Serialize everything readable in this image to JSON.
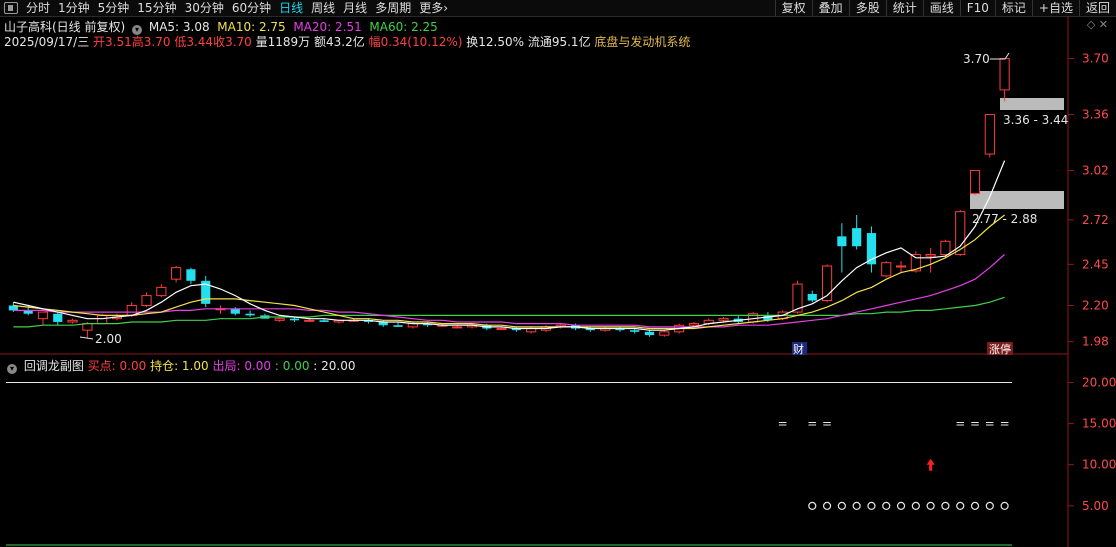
{
  "toolbar": {
    "periods": [
      "分时",
      "1分钟",
      "5分钟",
      "15分钟",
      "30分钟",
      "60分钟",
      "日线",
      "周线",
      "月线",
      "多周期",
      "更多"
    ],
    "active_index": 6,
    "more_arrow": "›",
    "right_buttons": [
      "复权",
      "叠加",
      "多股",
      "统计",
      "画线",
      "F10",
      "标记",
      "+自选",
      "返回"
    ]
  },
  "header": {
    "stock": "山子高科(日线 前复权)",
    "ma5": "MA5: 3.08",
    "ma10": "MA10: 2.75",
    "ma20": "MA20: 2.51",
    "ma60": "MA60: 2.25",
    "date": "2025/09/17/三",
    "open": "开3.51",
    "high": "高3.70",
    "low": "低3.44",
    "close": "收3.70",
    "volume": "量1189万",
    "amount": "额43.2亿",
    "change": "幅0.34(10.12%)",
    "turnover": "换12.50%",
    "float": "流通95.1亿",
    "system": "底盘与发动机系统"
  },
  "main_axis": [
    "3.70",
    "3.36",
    "3.02",
    "2.72",
    "2.45",
    "2.20",
    "1.98"
  ],
  "annotations": {
    "high_label": "3.70",
    "low_label": "2.00",
    "zone1_label": "3.36 - 3.44",
    "zone2_label": "2.77 - 2.88",
    "cai_label": "财",
    "zhangting_label": "涨停"
  },
  "sub_header": {
    "name": "回调龙副图",
    "buy": "买点: 0.00",
    "hold": "持仓: 1.00",
    "exit": "出局: 0.00",
    "v1": ": 0.00",
    "v2": ": 20.00"
  },
  "sub_axis": [
    "20.00",
    "15.00",
    "10.00",
    "5.00"
  ],
  "colors": {
    "up": "#ff3b3b",
    "down": "#22e0ee",
    "ma5": "#ffffff",
    "ma10": "#f2e24a",
    "ma20": "#e63fe6",
    "ma60": "#3fd24a"
  },
  "chart_data": {
    "type": "candlestick",
    "ylim": [
      1.96,
      3.74
    ],
    "candles": [
      {
        "o": 2.2,
        "h": 2.22,
        "l": 2.16,
        "c": 2.17
      },
      {
        "o": 2.17,
        "h": 2.2,
        "l": 2.14,
        "c": 2.15
      },
      {
        "o": 2.12,
        "h": 2.16,
        "l": 2.08,
        "c": 2.16
      },
      {
        "o": 2.15,
        "h": 2.16,
        "l": 2.08,
        "c": 2.1
      },
      {
        "o": 2.1,
        "h": 2.12,
        "l": 2.09,
        "c": 2.11
      },
      {
        "o": 2.05,
        "h": 2.1,
        "l": 2.0,
        "c": 2.09
      },
      {
        "o": 2.09,
        "h": 2.15,
        "l": 2.09,
        "c": 2.14
      },
      {
        "o": 2.12,
        "h": 2.15,
        "l": 2.11,
        "c": 2.13
      },
      {
        "o": 2.14,
        "h": 2.22,
        "l": 2.13,
        "c": 2.2
      },
      {
        "o": 2.2,
        "h": 2.28,
        "l": 2.19,
        "c": 2.26
      },
      {
        "o": 2.26,
        "h": 2.33,
        "l": 2.25,
        "c": 2.31
      },
      {
        "o": 2.36,
        "h": 2.44,
        "l": 2.34,
        "c": 2.43
      },
      {
        "o": 2.42,
        "h": 2.43,
        "l": 2.33,
        "c": 2.35
      },
      {
        "o": 2.35,
        "h": 2.38,
        "l": 2.19,
        "c": 2.21
      },
      {
        "o": 2.18,
        "h": 2.2,
        "l": 2.15,
        "c": 2.18
      },
      {
        "o": 2.18,
        "h": 2.19,
        "l": 2.14,
        "c": 2.15
      },
      {
        "o": 2.15,
        "h": 2.17,
        "l": 2.13,
        "c": 2.14
      },
      {
        "o": 2.14,
        "h": 2.15,
        "l": 2.12,
        "c": 2.12
      },
      {
        "o": 2.11,
        "h": 2.13,
        "l": 2.1,
        "c": 2.12
      },
      {
        "o": 2.12,
        "h": 2.13,
        "l": 2.1,
        "c": 2.11
      },
      {
        "o": 2.11,
        "h": 2.12,
        "l": 2.1,
        "c": 2.11
      },
      {
        "o": 2.11,
        "h": 2.12,
        "l": 2.1,
        "c": 2.1
      },
      {
        "o": 2.1,
        "h": 2.11,
        "l": 2.09,
        "c": 2.11
      },
      {
        "o": 2.11,
        "h": 2.12,
        "l": 2.1,
        "c": 2.11
      },
      {
        "o": 2.11,
        "h": 2.12,
        "l": 2.09,
        "c": 2.1
      },
      {
        "o": 2.1,
        "h": 2.11,
        "l": 2.07,
        "c": 2.08
      },
      {
        "o": 2.08,
        "h": 2.1,
        "l": 2.07,
        "c": 2.07
      },
      {
        "o": 2.07,
        "h": 2.1,
        "l": 2.06,
        "c": 2.09
      },
      {
        "o": 2.09,
        "h": 2.1,
        "l": 2.07,
        "c": 2.08
      },
      {
        "o": 2.08,
        "h": 2.09,
        "l": 2.07,
        "c": 2.08
      },
      {
        "o": 2.07,
        "h": 2.08,
        "l": 2.06,
        "c": 2.07
      },
      {
        "o": 2.07,
        "h": 2.09,
        "l": 2.06,
        "c": 2.08
      },
      {
        "o": 2.08,
        "h": 2.09,
        "l": 2.05,
        "c": 2.06
      },
      {
        "o": 2.06,
        "h": 2.07,
        "l": 2.05,
        "c": 2.06
      },
      {
        "o": 2.06,
        "h": 2.07,
        "l": 2.04,
        "c": 2.05
      },
      {
        "o": 2.04,
        "h": 2.07,
        "l": 2.03,
        "c": 2.06
      },
      {
        "o": 2.05,
        "h": 2.08,
        "l": 2.04,
        "c": 2.07
      },
      {
        "o": 2.07,
        "h": 2.09,
        "l": 2.06,
        "c": 2.08
      },
      {
        "o": 2.08,
        "h": 2.09,
        "l": 2.05,
        "c": 2.06
      },
      {
        "o": 2.06,
        "h": 2.07,
        "l": 2.04,
        "c": 2.05
      },
      {
        "o": 2.05,
        "h": 2.07,
        "l": 2.04,
        "c": 2.06
      },
      {
        "o": 2.06,
        "h": 2.07,
        "l": 2.04,
        "c": 2.05
      },
      {
        "o": 2.05,
        "h": 2.06,
        "l": 2.03,
        "c": 2.04
      },
      {
        "o": 2.04,
        "h": 2.05,
        "l": 2.01,
        "c": 2.02
      },
      {
        "o": 2.02,
        "h": 2.05,
        "l": 2.01,
        "c": 2.04
      },
      {
        "o": 2.04,
        "h": 2.09,
        "l": 2.03,
        "c": 2.08
      },
      {
        "o": 2.08,
        "h": 2.1,
        "l": 2.06,
        "c": 2.09
      },
      {
        "o": 2.09,
        "h": 2.12,
        "l": 2.08,
        "c": 2.11
      },
      {
        "o": 2.11,
        "h": 2.13,
        "l": 2.1,
        "c": 2.12
      },
      {
        "o": 2.12,
        "h": 2.14,
        "l": 2.09,
        "c": 2.1
      },
      {
        "o": 2.1,
        "h": 2.16,
        "l": 2.09,
        "c": 2.15
      },
      {
        "o": 2.14,
        "h": 2.16,
        "l": 2.1,
        "c": 2.11
      },
      {
        "o": 2.12,
        "h": 2.17,
        "l": 2.11,
        "c": 2.16
      },
      {
        "o": 2.16,
        "h": 2.35,
        "l": 2.15,
        "c": 2.33
      },
      {
        "o": 2.27,
        "h": 2.29,
        "l": 2.22,
        "c": 2.23
      },
      {
        "o": 2.23,
        "h": 2.45,
        "l": 2.22,
        "c": 2.44
      },
      {
        "o": 2.62,
        "h": 2.7,
        "l": 2.4,
        "c": 2.56
      },
      {
        "o": 2.67,
        "h": 2.75,
        "l": 2.54,
        "c": 2.56
      },
      {
        "o": 2.64,
        "h": 2.68,
        "l": 2.4,
        "c": 2.45
      },
      {
        "o": 2.38,
        "h": 2.47,
        "l": 2.37,
        "c": 2.46
      },
      {
        "o": 2.44,
        "h": 2.47,
        "l": 2.4,
        "c": 2.44
      },
      {
        "o": 2.41,
        "h": 2.53,
        "l": 2.4,
        "c": 2.51
      },
      {
        "o": 2.5,
        "h": 2.55,
        "l": 2.4,
        "c": 2.51
      },
      {
        "o": 2.51,
        "h": 2.6,
        "l": 2.49,
        "c": 2.59
      },
      {
        "o": 2.51,
        "h": 2.78,
        "l": 2.5,
        "c": 2.77
      },
      {
        "o": 2.88,
        "h": 3.02,
        "l": 2.87,
        "c": 3.02
      },
      {
        "o": 3.12,
        "h": 3.36,
        "l": 3.1,
        "c": 3.36
      },
      {
        "o": 3.51,
        "h": 3.7,
        "l": 3.44,
        "c": 3.7
      }
    ],
    "ma5": [
      2.22,
      2.2,
      2.18,
      2.16,
      2.14,
      2.12,
      2.12,
      2.13,
      2.14,
      2.17,
      2.22,
      2.28,
      2.32,
      2.33,
      2.3,
      2.26,
      2.21,
      2.17,
      2.14,
      2.13,
      2.12,
      2.12,
      2.11,
      2.11,
      2.11,
      2.1,
      2.1,
      2.09,
      2.09,
      2.08,
      2.08,
      2.08,
      2.07,
      2.07,
      2.06,
      2.06,
      2.06,
      2.07,
      2.07,
      2.06,
      2.06,
      2.06,
      2.06,
      2.05,
      2.05,
      2.06,
      2.07,
      2.09,
      2.1,
      2.11,
      2.12,
      2.13,
      2.14,
      2.18,
      2.21,
      2.26,
      2.35,
      2.43,
      2.48,
      2.52,
      2.55,
      2.49,
      2.49,
      2.5,
      2.56,
      2.68,
      2.86,
      3.08
    ],
    "ma10": [
      2.2,
      2.19,
      2.18,
      2.17,
      2.16,
      2.15,
      2.14,
      2.14,
      2.14,
      2.15,
      2.16,
      2.19,
      2.22,
      2.24,
      2.24,
      2.24,
      2.23,
      2.22,
      2.21,
      2.2,
      2.18,
      2.16,
      2.14,
      2.12,
      2.12,
      2.11,
      2.11,
      2.1,
      2.1,
      2.09,
      2.09,
      2.09,
      2.08,
      2.08,
      2.07,
      2.07,
      2.07,
      2.07,
      2.07,
      2.07,
      2.07,
      2.07,
      2.07,
      2.06,
      2.06,
      2.06,
      2.06,
      2.07,
      2.08,
      2.09,
      2.1,
      2.11,
      2.12,
      2.14,
      2.16,
      2.19,
      2.23,
      2.28,
      2.31,
      2.36,
      2.4,
      2.42,
      2.45,
      2.49,
      2.54,
      2.6,
      2.68,
      2.75
    ],
    "ma20": [
      2.17,
      2.17,
      2.17,
      2.16,
      2.16,
      2.16,
      2.16,
      2.16,
      2.16,
      2.16,
      2.16,
      2.17,
      2.17,
      2.18,
      2.18,
      2.18,
      2.18,
      2.18,
      2.18,
      2.18,
      2.17,
      2.17,
      2.16,
      2.16,
      2.15,
      2.14,
      2.13,
      2.12,
      2.11,
      2.11,
      2.1,
      2.1,
      2.1,
      2.1,
      2.09,
      2.09,
      2.09,
      2.09,
      2.08,
      2.08,
      2.08,
      2.08,
      2.08,
      2.07,
      2.07,
      2.07,
      2.07,
      2.07,
      2.07,
      2.08,
      2.08,
      2.08,
      2.09,
      2.1,
      2.11,
      2.12,
      2.14,
      2.16,
      2.18,
      2.2,
      2.22,
      2.24,
      2.26,
      2.29,
      2.32,
      2.36,
      2.43,
      2.51
    ],
    "ma60": [
      2.07,
      2.07,
      2.08,
      2.08,
      2.08,
      2.09,
      2.09,
      2.09,
      2.1,
      2.1,
      2.1,
      2.11,
      2.11,
      2.11,
      2.12,
      2.12,
      2.12,
      2.13,
      2.13,
      2.13,
      2.13,
      2.14,
      2.14,
      2.14,
      2.14,
      2.14,
      2.14,
      2.14,
      2.14,
      2.14,
      2.14,
      2.14,
      2.14,
      2.14,
      2.14,
      2.14,
      2.14,
      2.14,
      2.14,
      2.14,
      2.14,
      2.14,
      2.14,
      2.14,
      2.14,
      2.14,
      2.14,
      2.14,
      2.14,
      2.14,
      2.14,
      2.14,
      2.14,
      2.14,
      2.14,
      2.14,
      2.14,
      2.15,
      2.15,
      2.16,
      2.16,
      2.17,
      2.17,
      2.18,
      2.19,
      2.2,
      2.22,
      2.25
    ],
    "sub_ylim": [
      0,
      22
    ],
    "sub_line_value": 20,
    "sub_base_value": 0,
    "sub_equals": [
      {
        "i": 52,
        "v": 15
      },
      {
        "i": 54,
        "v": 15
      },
      {
        "i": 55,
        "v": 15
      },
      {
        "i": 64,
        "v": 15
      },
      {
        "i": 65,
        "v": 15
      },
      {
        "i": 66,
        "v": 15
      },
      {
        "i": 67,
        "v": 15
      }
    ],
    "sub_circles": {
      "from": 54,
      "to": 67,
      "v": 5
    },
    "sub_arrow": {
      "i": 62,
      "v": 10
    }
  }
}
